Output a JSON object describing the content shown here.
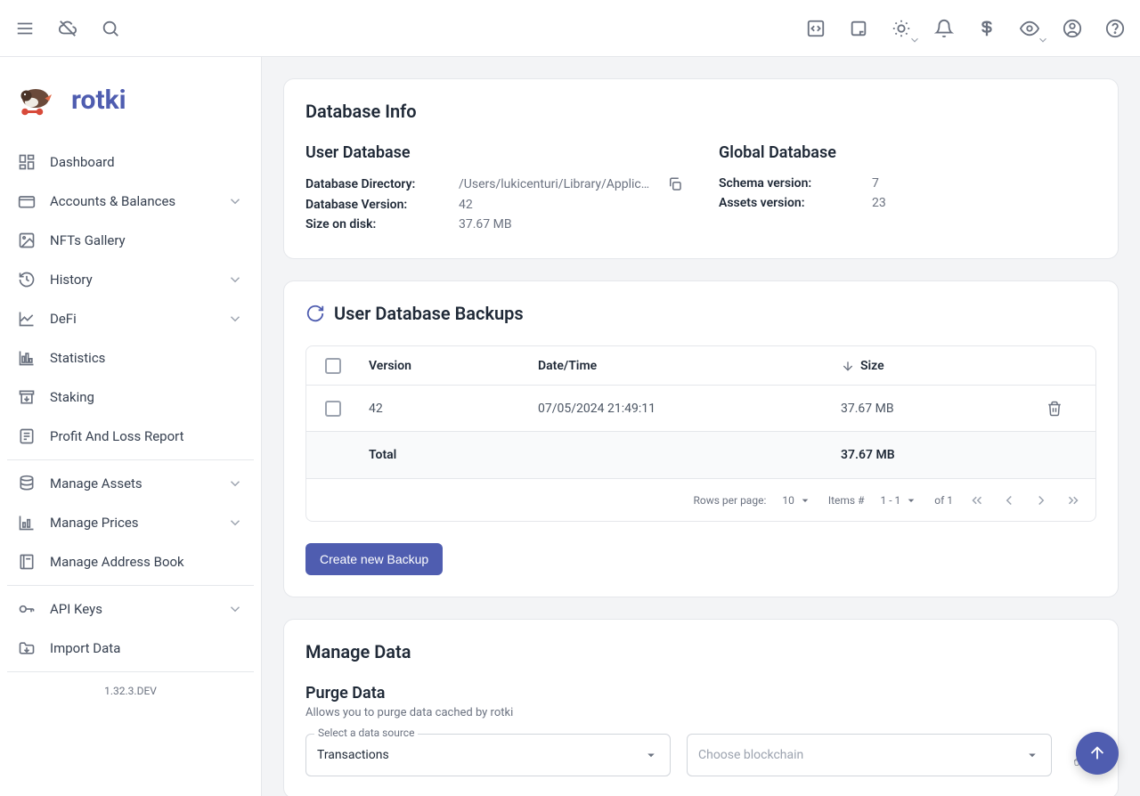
{
  "app": {
    "name": "rotki",
    "version": "1.32.3.DEV"
  },
  "sidebar": [
    {
      "label": "Dashboard",
      "icon": "dashboard-icon",
      "expandable": false
    },
    {
      "label": "Accounts & Balances",
      "icon": "wallet-icon",
      "expandable": true
    },
    {
      "label": "NFTs Gallery",
      "icon": "image-icon",
      "expandable": false
    },
    {
      "label": "History",
      "icon": "history-icon",
      "expandable": true
    },
    {
      "label": "DeFi",
      "icon": "chart-line-icon",
      "expandable": true
    },
    {
      "label": "Statistics",
      "icon": "bar-chart-icon",
      "expandable": false
    },
    {
      "label": "Staking",
      "icon": "archive-in-icon",
      "expandable": false
    },
    {
      "label": "Profit And Loss Report",
      "icon": "report-icon",
      "expandable": false
    },
    {
      "divider": true
    },
    {
      "label": "Manage Assets",
      "icon": "database-icon",
      "expandable": true
    },
    {
      "label": "Manage Prices",
      "icon": "price-chart-icon",
      "expandable": true
    },
    {
      "label": "Manage Address Book",
      "icon": "book-icon",
      "expandable": false
    },
    {
      "divider": true
    },
    {
      "label": "API Keys",
      "icon": "key-icon",
      "expandable": true
    },
    {
      "label": "Import Data",
      "icon": "folder-in-icon",
      "expandable": false
    },
    {
      "divider": true
    }
  ],
  "databaseInfo": {
    "title": "Database Info",
    "user": {
      "title": "User Database",
      "directory_label": "Database Directory:",
      "directory_value": "/Users/lukicenturi/Library/Applic…",
      "version_label": "Database Version:",
      "version_value": "42",
      "size_label": "Size on disk:",
      "size_value": "37.67 MB"
    },
    "global": {
      "title": "Global Database",
      "schema_label": "Schema version:",
      "schema_value": "7",
      "assets_label": "Assets version:",
      "assets_value": "23"
    }
  },
  "backups": {
    "title": "User Database Backups",
    "columns": {
      "version": "Version",
      "datetime": "Date/Time",
      "size": "Size"
    },
    "rows": [
      {
        "version": "42",
        "datetime": "07/05/2024 21:49:11",
        "size": "37.67 MB"
      }
    ],
    "total_label": "Total",
    "total_size": "37.67 MB",
    "pager": {
      "rows_label": "Rows per page:",
      "rows_value": "10",
      "items_label": "Items #",
      "items_range": "1 - 1",
      "of_label": "of 1"
    },
    "create_button": "Create new Backup"
  },
  "manageData": {
    "title": "Manage Data",
    "purge": {
      "title": "Purge Data",
      "desc": "Allows you to purge data cached by rotki",
      "source_legend": "Select a data source",
      "source_value": "Transactions",
      "blockchain_placeholder": "Choose blockchain"
    }
  }
}
